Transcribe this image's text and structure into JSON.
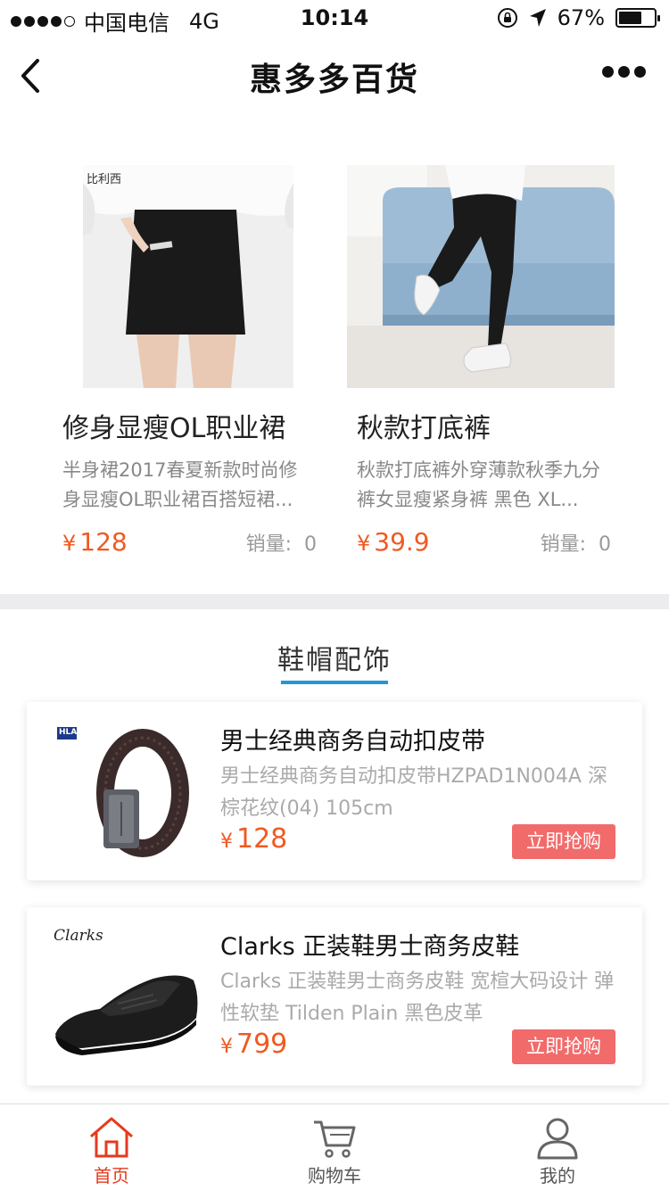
{
  "status_bar": {
    "carrier": "中国电信",
    "network": "4G",
    "time": "10:14",
    "battery": "67%",
    "battery_level": 0.67
  },
  "nav": {
    "title": "惠多多百货"
  },
  "grid_products": [
    {
      "name": "修身显瘦OL职业裙",
      "desc": "半身裙2017春夏新款时尚修身显瘦OL职业裙百搭短裙...",
      "price": "128",
      "sales_label": "销量:",
      "sales": "0",
      "brand_mark": "比利西"
    },
    {
      "name": "秋款打底裤",
      "desc": "秋款打底裤外穿薄款秋季九分裤女显瘦紧身裤 黑色 XL...",
      "price": "39.9",
      "sales_label": "销量:",
      "sales": "0"
    }
  ],
  "currency": "¥",
  "section": {
    "title": "鞋帽配饰"
  },
  "list_products": [
    {
      "title": "男士经典商务自动扣皮带",
      "desc": "男士经典商务自动扣皮带HZPAD1N004A 深棕花纹(04) 105cm",
      "price": "128",
      "buy_label": "立即抢购",
      "brand_mark": "HLA"
    },
    {
      "title": "Clarks 正装鞋男士商务皮鞋",
      "desc": "Clarks 正装鞋男士商务皮鞋 宽楦大码设计 弹性软垫 Tilden Plain 黑色皮革",
      "price": "799",
      "buy_label": "立即抢购",
      "brand_mark": "Clarks"
    }
  ],
  "tabbar": [
    {
      "label": "首页",
      "icon": "home-icon",
      "active": true
    },
    {
      "label": "购物车",
      "icon": "cart-icon",
      "active": false
    },
    {
      "label": "我的",
      "icon": "user-icon",
      "active": false
    }
  ],
  "colors": {
    "price": "#f05a22",
    "buy_button": "#f26b6b",
    "section_underline": "#2196d8",
    "tab_active": "#e53a1e"
  }
}
